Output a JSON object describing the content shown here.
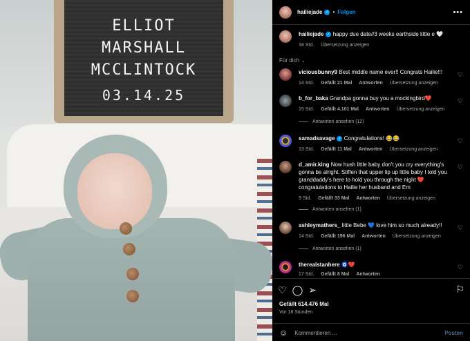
{
  "post": {
    "author": "hailiejade",
    "follow_label": "Folgen",
    "dot": "•",
    "more": "•••",
    "letterboard": [
      "ELLIOT",
      "MARSHALL",
      "MCCLINTOCK",
      "03.14.25"
    ]
  },
  "caption": {
    "text": "happy due date//3 weeks earthside little e 🤍",
    "time": "18 Std.",
    "translate": "Übersetzung anzeigen"
  },
  "sort_label": "Für dich",
  "comments": [
    {
      "user": "viciousbunny9",
      "text": "Best middle name ever!! Congrats Hailie!!!",
      "time": "14 Std.",
      "likes": "Gefällt 21 Mal",
      "reply": "Antworten",
      "translate": "Übersetzung anzeigen"
    },
    {
      "user": "b_for_baka",
      "text": "Grandpa gonna buy you a mockingbird❤️",
      "time": "15 Std.",
      "likes": "Gefällt 4.101 Mal",
      "reply": "Antworten",
      "translate": "Übersetzung anzeigen",
      "view_replies": "Antworten ansehen (12)"
    },
    {
      "user": "samadsavage",
      "verified": true,
      "text": "Congratulations! 😂😂",
      "time": "13 Std.",
      "likes": "Gefällt 11 Mal",
      "reply": "Antworten",
      "translate": "Übersetzung anzeigen"
    },
    {
      "user": "d_amir.king",
      "text": "Now hush little baby don't you cry everything's gonna be alright. Stiffen that upper lip up little baby I told you granddaddy's here to hold you through the night ❤️ congratulations to Hailie her husband and Em",
      "time": "9 Std.",
      "likes": "Gefällt 33 Mal",
      "reply": "Antworten",
      "translate": "Übersetzung anzeigen",
      "view_replies": "Antworten ansehen (1)"
    },
    {
      "user": "ashleymathers_",
      "text": "little Bebe 💙 love him so much already!!",
      "time": "14 Std.",
      "likes": "Gefällt 196 Mal",
      "reply": "Antworten",
      "translate": "Übersetzung anzeigen",
      "view_replies": "Antworten ansehen (1)"
    },
    {
      "user": "therealstanhere",
      "text": "🧿❤️",
      "time": "17 Std.",
      "likes": "Gefällt 8 Mal",
      "reply": "Antworten"
    }
  ],
  "footer": {
    "likes": "Gefällt 614.476 Mal",
    "time": "Vor 18 Stunden",
    "comment_placeholder": "Kommentieren ...",
    "post_label": "Posten"
  },
  "icons": [
    "heart-icon",
    "comment-icon",
    "share-icon",
    "bookmark-icon",
    "emoji-icon",
    "more-icon"
  ]
}
